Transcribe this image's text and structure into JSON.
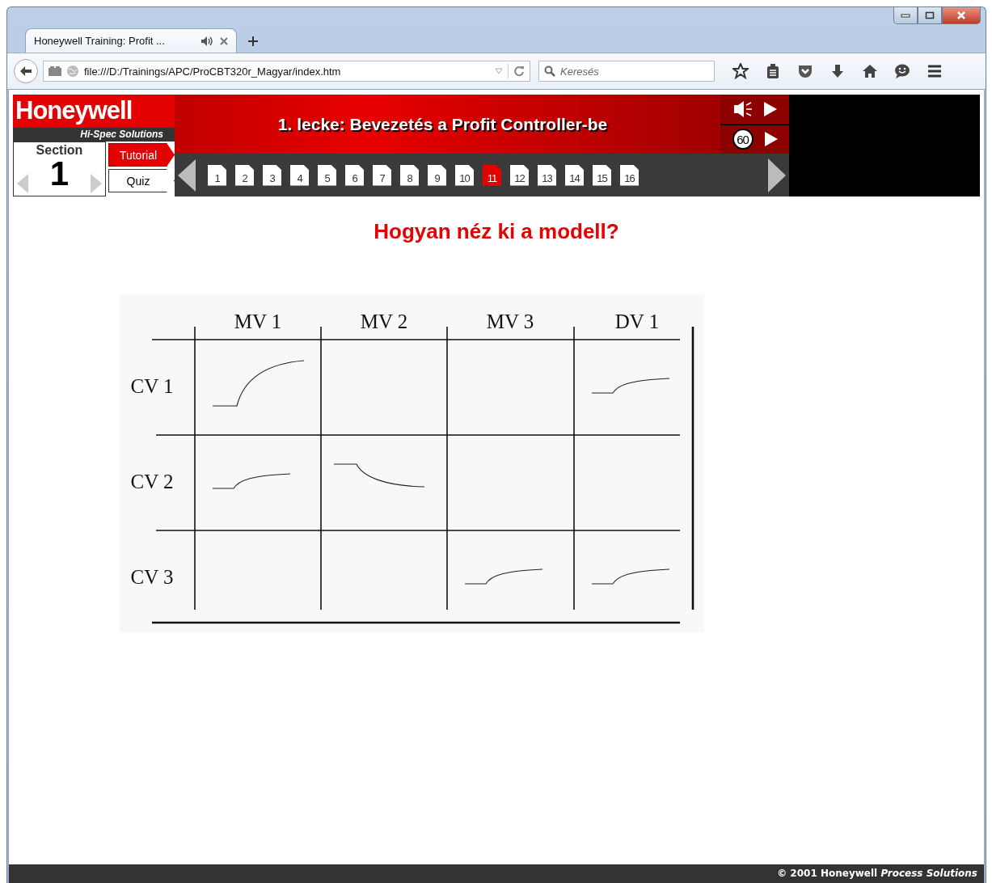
{
  "browser": {
    "tab_title": "Honeywell Training: Profit ...",
    "address": "file:///D:/Trainings/APC/ProCBT320r_Magyar/index.htm",
    "search": {
      "placeholder": "Keresés"
    }
  },
  "course": {
    "logo": {
      "brand": "Honeywell",
      "tagline": "Hi-Spec Solutions"
    },
    "lesson_title": "1. lecke: Bevezetés a Profit Controller-be",
    "timer": "60",
    "section": {
      "label": "Section",
      "number": "1"
    },
    "modes": [
      {
        "label": "Tutorial",
        "selected": true
      },
      {
        "label": "Quiz",
        "selected": false
      }
    ],
    "pages": [
      {
        "label": "1",
        "selected": false
      },
      {
        "label": "2",
        "selected": false
      },
      {
        "label": "3",
        "selected": false
      },
      {
        "label": "4",
        "selected": false
      },
      {
        "label": "5",
        "selected": false
      },
      {
        "label": "6",
        "selected": false
      },
      {
        "label": "7",
        "selected": false
      },
      {
        "label": "8",
        "selected": false
      },
      {
        "label": "9",
        "selected": false
      },
      {
        "label": "10",
        "selected": false
      },
      {
        "label": "11",
        "selected": true
      },
      {
        "label": "12",
        "selected": false
      },
      {
        "label": "13",
        "selected": false
      },
      {
        "label": "14",
        "selected": false
      },
      {
        "label": "15",
        "selected": false
      },
      {
        "label": "16",
        "selected": false
      }
    ]
  },
  "slide": {
    "heading": "Hogyan néz ki a modell?",
    "matrix": {
      "columns": [
        "MV 1",
        "MV 2",
        "MV 3",
        "DV 1"
      ],
      "rows": [
        {
          "label": "CV 1",
          "cells": [
            {
              "kind": "large_rise"
            },
            {
              "kind": "none"
            },
            {
              "kind": "none"
            },
            {
              "kind": "small_rise"
            }
          ]
        },
        {
          "label": "CV 2",
          "cells": [
            {
              "kind": "small_rise"
            },
            {
              "kind": "fall"
            },
            {
              "kind": "none"
            },
            {
              "kind": "none"
            }
          ]
        },
        {
          "label": "CV 3",
          "cells": [
            {
              "kind": "none"
            },
            {
              "kind": "none"
            },
            {
              "kind": "small_rise"
            },
            {
              "kind": "small_rise"
            }
          ]
        }
      ]
    }
  },
  "footer": {
    "copyright": "© 2001 Honeywell *Process Solutions*"
  }
}
